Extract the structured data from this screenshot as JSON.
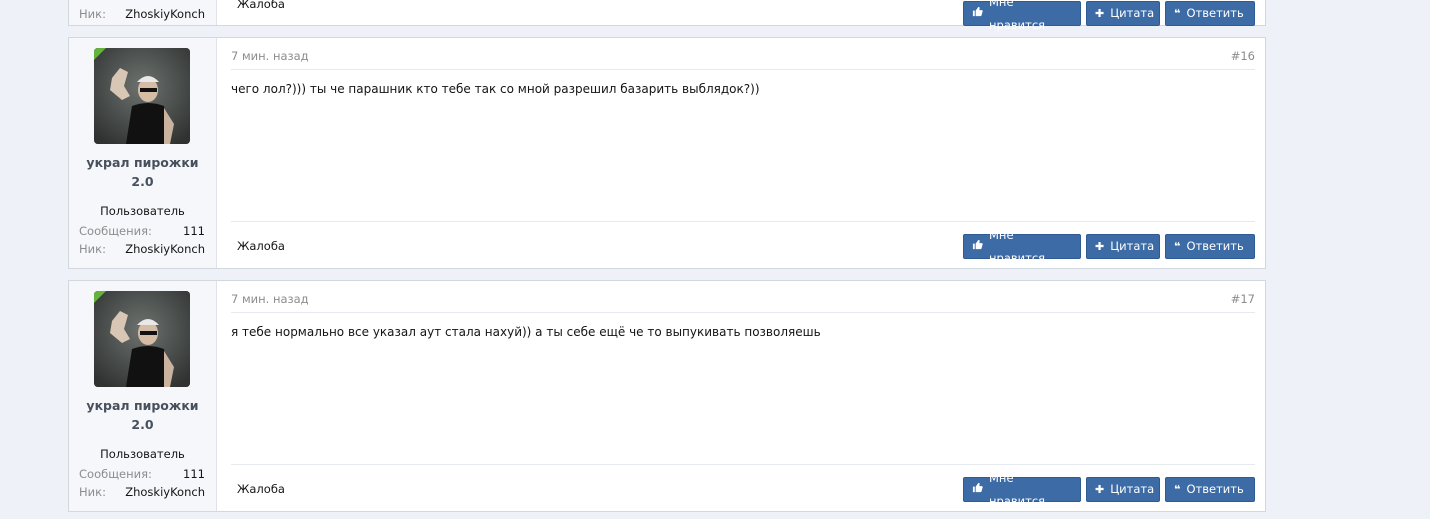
{
  "posts": [
    {
      "user": {
        "name": "",
        "title": "",
        "messages_label": "Сообщения:",
        "messages": "",
        "nick_label": "Ник:",
        "nick": "ZhoskiyKonch"
      },
      "report": "Жалоба",
      "actions": {
        "like": "Мне нравится",
        "quote": "Цитата",
        "reply": "Ответить"
      }
    },
    {
      "date": "7 мин. назад",
      "number": "#16",
      "text": "чего лол?))) ты че парашник кто тебе так со мной разрешил базарить выблядок?))",
      "user": {
        "name_line1": "украл пирожки",
        "name_line2": "2.0",
        "title": "Пользователь",
        "messages_label": "Сообщения:",
        "messages": "111",
        "nick_label": "Ник:",
        "nick": "ZhoskiyKonch",
        "online": true
      },
      "report": "Жалоба",
      "actions": {
        "like": "Мне нравится",
        "quote": "Цитата",
        "reply": "Ответить"
      }
    },
    {
      "date": "7 мин. назад",
      "number": "#17",
      "text": "я тебе нормально все указал аут стала нахуй)) а ты себе ещё че то выпукивать позволяешь",
      "user": {
        "name_line1": "украл пирожки",
        "name_line2": "2.0",
        "title": "Пользователь",
        "messages_label": "Сообщения:",
        "messages": "111",
        "nick_label": "Ник:",
        "nick": "ZhoskiyKonch",
        "online": true
      },
      "report": "Жалоба",
      "actions": {
        "like": "Мне нравится",
        "quote": "Цитата",
        "reply": "Ответить"
      }
    }
  ],
  "icons": {
    "like": "thumbs-up-icon",
    "quote": "plus-icon",
    "reply": "quote-icon",
    "online": "online-badge-icon"
  },
  "colors": {
    "button": "#3d6ba6",
    "online": "#63b33d",
    "background": "#eef1f7"
  }
}
